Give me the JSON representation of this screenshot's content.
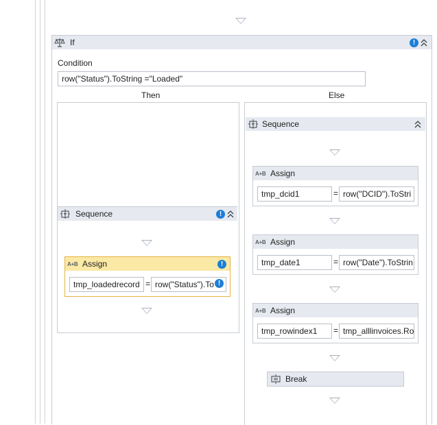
{
  "if_activity": {
    "title": "If",
    "condition_label": "Condition",
    "condition_value": "row(\"Status\").ToString =\"Loaded\"",
    "then_label": "Then",
    "else_label": "Else",
    "then_sequence": {
      "title": "Sequence",
      "assign": {
        "title": "Assign",
        "to": "tmp_loadedrecord",
        "equals": "=",
        "value": "row(\"Status\").To"
      }
    },
    "else_sequence": {
      "title": "Sequence",
      "assigns": [
        {
          "title": "Assign",
          "to": "tmp_dcid1",
          "equals": "=",
          "value": "row(\"DCID\").ToStri"
        },
        {
          "title": "Assign",
          "to": "tmp_date1",
          "equals": "=",
          "value": "row(\"Date\").ToStrin"
        },
        {
          "title": "Assign",
          "to": "tmp_rowindex1",
          "equals": "=",
          "value": "tmp_alllinvoices.Ro"
        }
      ],
      "break": {
        "title": "Break"
      }
    }
  },
  "icons": {
    "if": "scales-icon",
    "sequence": "sequence-icon",
    "assign": "assign-icon",
    "break": "break-icon",
    "warning": "warning-icon",
    "collapse": "collapse-chevron-icon"
  },
  "colors": {
    "header_bg": "#e6e9ef",
    "selected_header_bg": "#fbe9a6",
    "selected_border": "#e3b341",
    "warning": "#1c7fd6",
    "arrow": "#a7b0bb"
  }
}
